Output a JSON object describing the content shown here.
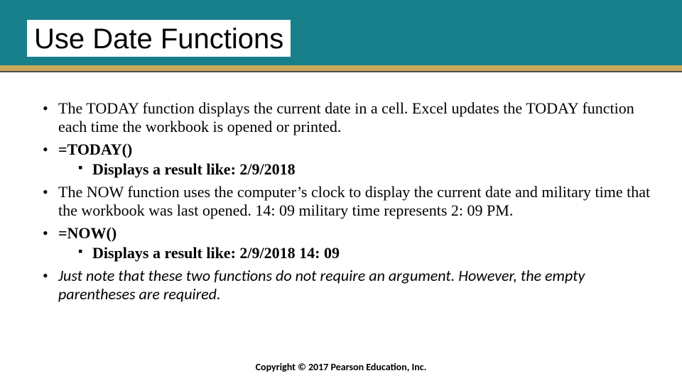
{
  "title": "Use Date Functions",
  "bullets": [
    {
      "text": "The TODAY function displays the current date in a cell. Excel updates the TODAY function each time the workbook is opened or printed.",
      "bold": false
    },
    {
      "text": "=TODAY()",
      "bold": true,
      "sub": [
        {
          "text": "Displays a result like: 2/9/2018"
        }
      ]
    },
    {
      "text": "The NOW function uses the computer’s clock to display the current date and military time that the workbook was last opened. 14: 09 military time represents 2: 09 PM.",
      "bold": false
    },
    {
      "text": "=NOW()",
      "bold": true,
      "sub": [
        {
          "text": "Displays a result like: 2/9/2018 14: 09"
        }
      ]
    },
    {
      "text": "Just note that these two functions do not require an argument. However, the empty parentheses are required.",
      "sansItalic": true
    }
  ],
  "footer": "Copyright © 2017 Pearson Education, Inc."
}
